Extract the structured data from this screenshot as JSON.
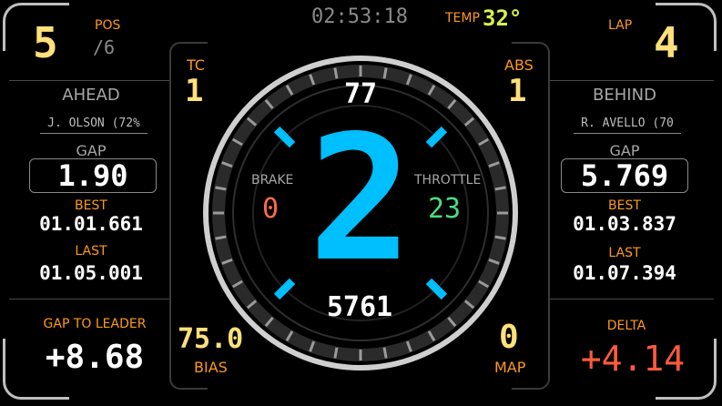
{
  "position": {
    "label": "POS",
    "value": "5",
    "total": "/6"
  },
  "clock": "02:53:18",
  "temp": {
    "label": "TEMP",
    "value": "32°"
  },
  "lap": {
    "label": "LAP",
    "value": "4"
  },
  "tc": {
    "label": "TC",
    "value": "1"
  },
  "abs": {
    "label": "ABS",
    "value": "1"
  },
  "ahead": {
    "label": "AHEAD",
    "driver": "J. OLSON (72%",
    "gap_label": "GAP",
    "gap": "1.90",
    "best_label": "BEST",
    "best": "01.01.661",
    "last_label": "LAST",
    "last": "01.05.001"
  },
  "behind": {
    "label": "BEHIND",
    "driver": "R. AVELLO (70",
    "gap_label": "GAP",
    "gap": "5.769",
    "best_label": "BEST",
    "best": "01.03.837",
    "last_label": "LAST",
    "last": "01.07.394"
  },
  "gauge": {
    "speed": "77",
    "gear": "2",
    "rpm": "5761",
    "brake_label": "BRAKE",
    "brake": "0",
    "throttle_label": "THROTTLE",
    "throttle": "23",
    "accent": "#00bfff"
  },
  "gap_to_leader": {
    "label": "GAP TO LEADER",
    "value": "+8.68"
  },
  "bias": {
    "label": "BIAS",
    "value": "75.0"
  },
  "map": {
    "label": "MAP",
    "value": "0"
  },
  "delta": {
    "label": "DELTA",
    "value": "+4.14",
    "color": "#ff5a3c"
  }
}
